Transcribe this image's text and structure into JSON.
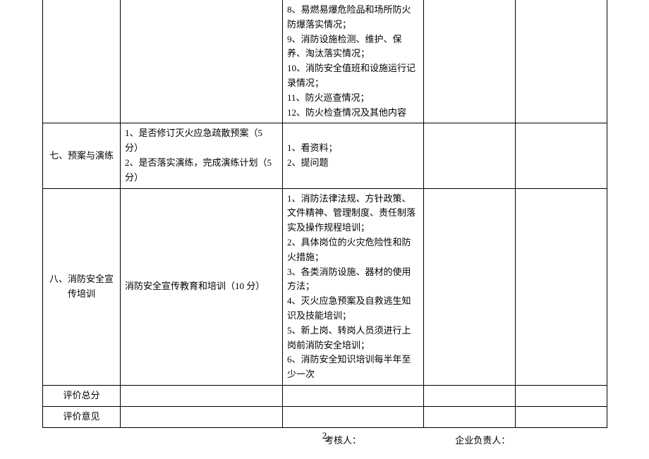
{
  "rows": [
    {
      "col1": "",
      "col2": "",
      "col3": "8、易燃易爆危险品和场所防火防爆落实情况；\n9、消防设施检测、维护、保养、淘汰落实情况；\n10、消防安全值班和设施运行记录情况；\n11、防火巡查情况；\n12、防火检查情况及其他内容",
      "col4": "",
      "col5": ""
    },
    {
      "col1": "七、预案与演练",
      "col2": "1、是否修订灭火应急疏散预案（5 分）\n2、是否落实演练，完成演练计划（5 分）",
      "col3": "1、看资料；\n2、提问题",
      "col4": "",
      "col5": ""
    },
    {
      "col1": "八、消防安全宣传培训",
      "col2": "消防安全宣传教育和培训（10 分）",
      "col3": "1、消防法律法规、方针政策、文件精神、管理制度、责任制落实及操作规程培训；\n2、具体岗位的火灾危险性和防火措施；\n3、各类消防设施、器材的使用方法；\n4、灭火应急预案及自救逃生知识及技能培训；\n5、新上岗、转岗人员须进行上岗前消防安全培训；\n6、消防安全知识培训每半年至少一次",
      "col4": "",
      "col5": ""
    },
    {
      "col1": "评价总分",
      "col2": "",
      "col3": "",
      "col4": "",
      "col5": ""
    },
    {
      "col1": "评价意见",
      "col2": "",
      "col3": "",
      "col4": "",
      "col5": ""
    }
  ],
  "signatures": {
    "assessor": "考核人：",
    "responsible": "企业负责人："
  },
  "page_number": "2"
}
